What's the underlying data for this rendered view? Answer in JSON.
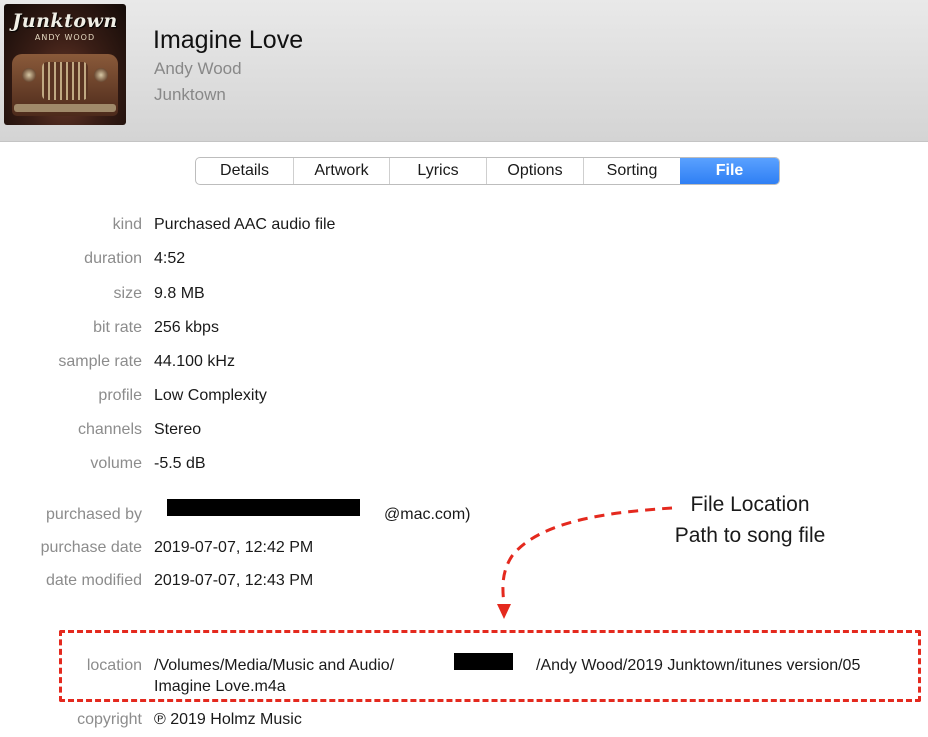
{
  "cover": {
    "brand": "Junktown",
    "artist_caption": "ANDY WOOD"
  },
  "song": {
    "title": "Imagine Love",
    "artist": "Andy Wood",
    "album": "Junktown"
  },
  "tabs": [
    {
      "label": "Details",
      "active": false
    },
    {
      "label": "Artwork",
      "active": false
    },
    {
      "label": "Lyrics",
      "active": false
    },
    {
      "label": "Options",
      "active": false
    },
    {
      "label": "Sorting",
      "active": false
    },
    {
      "label": "File",
      "active": true
    }
  ],
  "fields": {
    "kind": {
      "label": "kind",
      "value": "Purchased AAC audio file"
    },
    "duration": {
      "label": "duration",
      "value": "4:52"
    },
    "size": {
      "label": "size",
      "value": "9.8 MB"
    },
    "bit_rate": {
      "label": "bit rate",
      "value": "256 kbps"
    },
    "sample_rate": {
      "label": "sample rate",
      "value": "44.100 kHz"
    },
    "profile": {
      "label": "profile",
      "value": "Low Complexity"
    },
    "channels": {
      "label": "channels",
      "value": "Stereo"
    },
    "volume": {
      "label": "volume",
      "value": "-5.5 dB"
    },
    "purchased_by": {
      "label": "purchased by",
      "value_suffix": "@mac.com)"
    },
    "purchase_date": {
      "label": "purchase date",
      "value": "2019-07-07, 12:42 PM"
    },
    "date_modified": {
      "label": "date modified",
      "value": "2019-07-07, 12:43 PM"
    },
    "location": {
      "label": "location",
      "path_part1": "/Volumes/Media/Music and Audio/",
      "path_part2": "/Andy Wood/2019 Junktown/itunes version/05",
      "path_line2": "Imagine Love.m4a"
    },
    "copyright": {
      "label": "copyright",
      "value": "℗ 2019 Holmz Music"
    }
  },
  "annotation": {
    "line1": "File Location",
    "line2": "Path to song file",
    "color": "#e4291e"
  },
  "colors": {
    "accent_tab": "#2f7ff4",
    "label_gray": "#8c8c8c",
    "annotation_red": "#e4291e"
  }
}
